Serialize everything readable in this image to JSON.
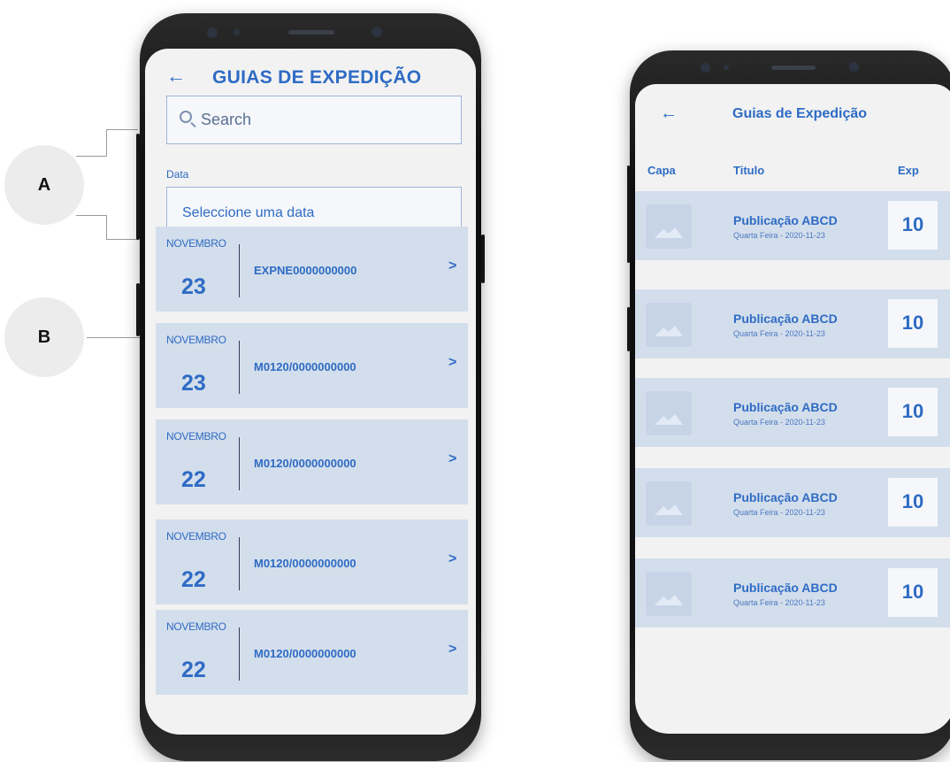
{
  "callouts": {
    "a": "A",
    "b": "B"
  },
  "left_phone": {
    "back_icon": "arrow-left-icon",
    "back_glyph": "←",
    "title": "GUIAS DE EXPEDIÇÃO",
    "search": {
      "placeholder": "Search"
    },
    "date": {
      "label": "Data",
      "placeholder": "Seleccione uma data"
    },
    "items": [
      {
        "month": "NOVEMBRO",
        "day": "23",
        "code": "EXPNE0000000000",
        "chevron": ">"
      },
      {
        "month": "NOVEMBRO",
        "day": "23",
        "code": "M0120/0000000000",
        "chevron": ">"
      },
      {
        "month": "NOVEMBRO",
        "day": "22",
        "code": "M0120/0000000000",
        "chevron": ">"
      },
      {
        "month": "NOVEMBRO",
        "day": "22",
        "code": "M0120/0000000000",
        "chevron": ">"
      },
      {
        "month": "NOVEMBRO",
        "day": "22",
        "code": "M0120/0000000000",
        "chevron": ">"
      }
    ]
  },
  "right_phone": {
    "back_glyph": "←",
    "title": "Guias de Expedição",
    "columns": {
      "capa": "Capa",
      "titulo": "Titulo",
      "exp": "Exp"
    },
    "items": [
      {
        "title": "Publicação ABCD",
        "subtitle": "Quarta Feira - 2020-11-23",
        "exp": "10"
      },
      {
        "title": "Publicação ABCD",
        "subtitle": "Quarta Feira - 2020-11-23",
        "exp": "10"
      },
      {
        "title": "Publicação ABCD",
        "subtitle": "Quarta Feira - 2020-11-23",
        "exp": "10"
      },
      {
        "title": "Publicação ABCD",
        "subtitle": "Quarta Feira - 2020-11-23",
        "exp": "10"
      },
      {
        "title": "Publicação ABCD",
        "subtitle": "Quarta Feira - 2020-11-23",
        "exp": "10"
      }
    ]
  },
  "colors": {
    "accent": "#2e6bc4",
    "card": "#d3deec",
    "screen": "#f2f2f2"
  }
}
